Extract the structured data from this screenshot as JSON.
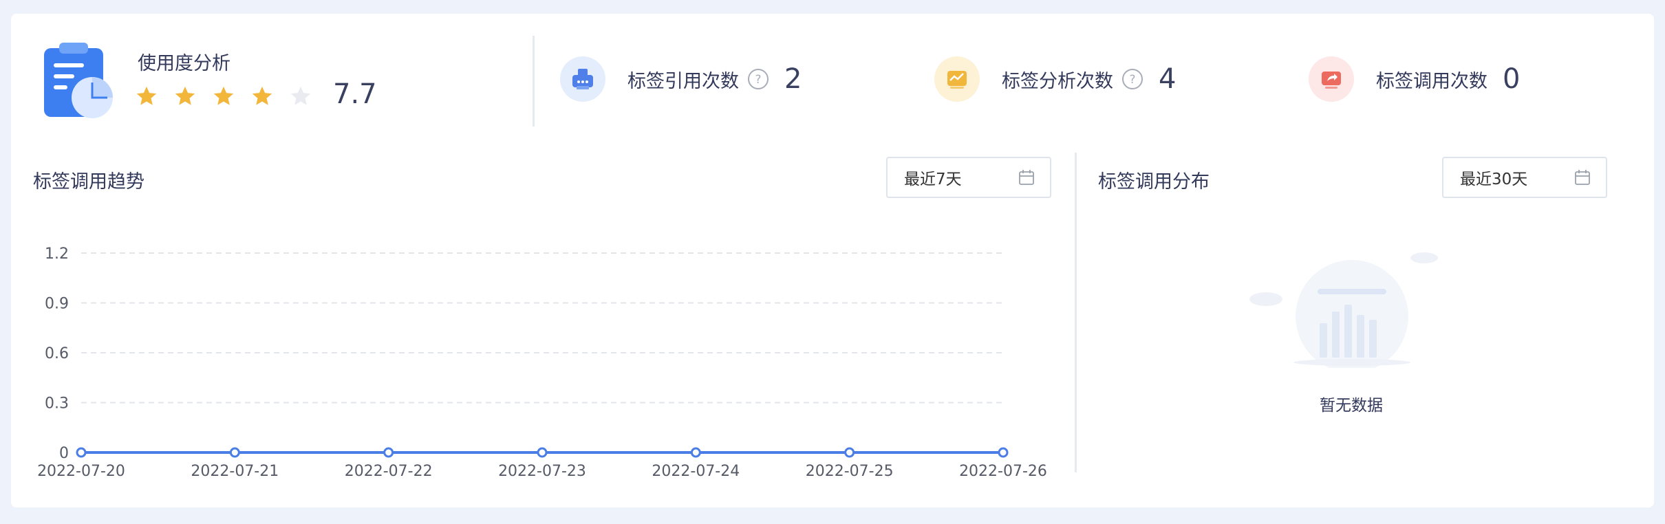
{
  "usage": {
    "title": "使用度分析",
    "rating_stars": 4,
    "max_stars": 5,
    "score": "7.7"
  },
  "stats": [
    {
      "label": "标签引用次数",
      "value": "2",
      "icon": "printer-icon",
      "icon_bg": "#e4edfc",
      "icon_color": "#4f7fe8",
      "help": true
    },
    {
      "label": "标签分析次数",
      "value": "4",
      "icon": "tray-icon",
      "icon_bg": "#fdf1d6",
      "icon_color": "#f1b63c",
      "help": true
    },
    {
      "label": "标签调用次数",
      "value": "0",
      "icon": "share-screen-icon",
      "icon_bg": "#fde7e7",
      "icon_color": "#ec6a5e",
      "help": false
    }
  ],
  "trend": {
    "title": "标签调用趋势",
    "range_label": "最近7天"
  },
  "distribution": {
    "title": "标签调用分布",
    "range_label": "最近30天",
    "empty_text": "暂无数据"
  },
  "colors": {
    "accent": "#4a7ee6",
    "star": "#f2b63a",
    "star_empty": "#e9ebf0"
  },
  "chart_data": {
    "type": "line",
    "x": [
      "2022-07-20",
      "2022-07-21",
      "2022-07-22",
      "2022-07-23",
      "2022-07-24",
      "2022-07-25",
      "2022-07-26"
    ],
    "series": [
      {
        "values": [
          0,
          0,
          0,
          0,
          0,
          0,
          0
        ]
      }
    ],
    "yticks": [
      "0",
      "0.3",
      "0.6",
      "0.9",
      "1.2"
    ],
    "ylim": [
      0,
      1.2
    ],
    "grid": true,
    "legend": "none"
  }
}
